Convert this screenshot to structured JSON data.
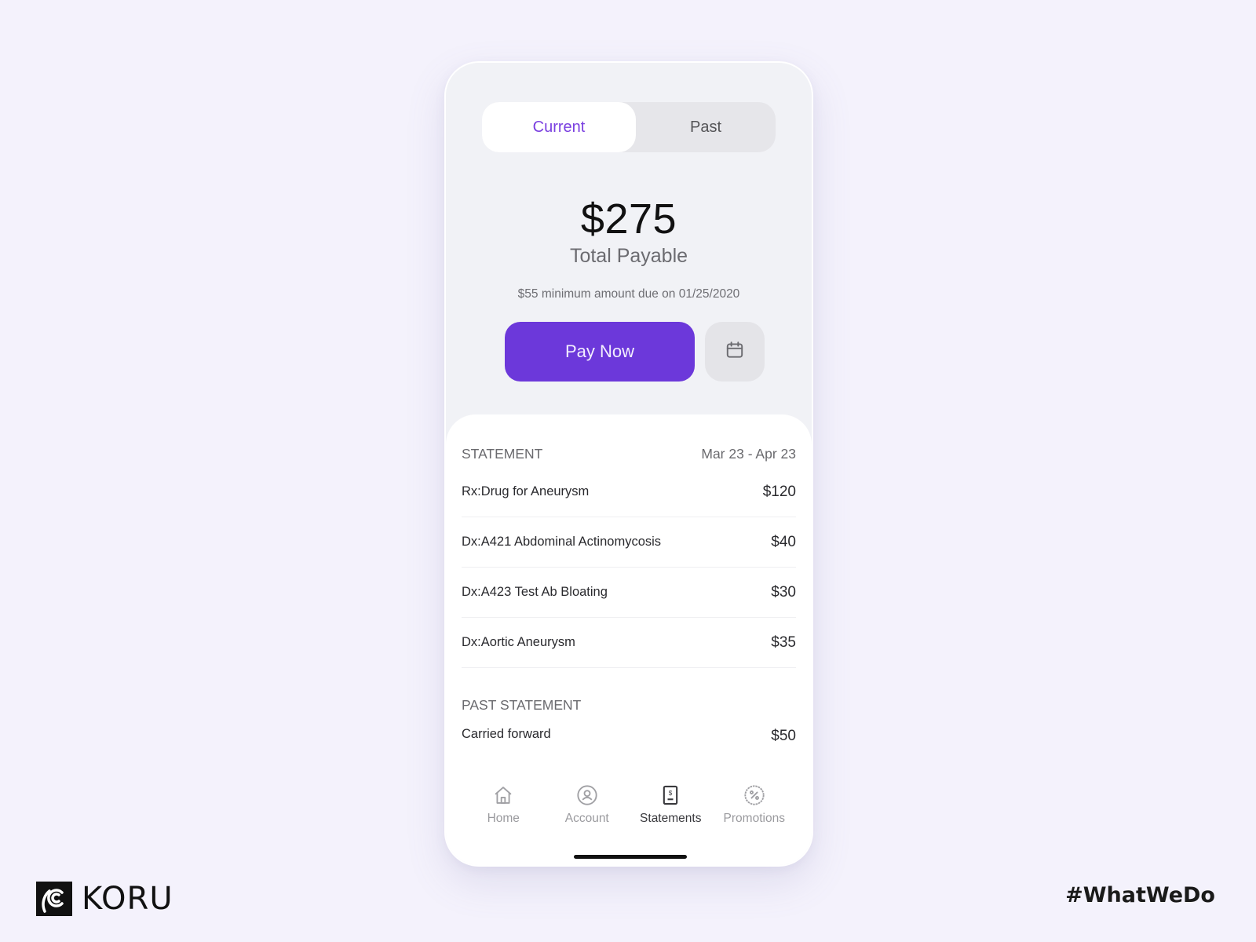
{
  "segmented_control": {
    "tabs": [
      {
        "label": "Current",
        "active": true
      },
      {
        "label": "Past",
        "active": false
      }
    ]
  },
  "summary": {
    "amount": "$275",
    "label": "Total Payable",
    "minimum_due": "$55 minimum amount due on 01/25/2020"
  },
  "actions": {
    "pay_now_label": "Pay Now",
    "schedule_icon": "calendar-icon"
  },
  "statement": {
    "title": "STATEMENT",
    "period": "Mar 23 - Apr 23",
    "items": [
      {
        "label": "Rx:Drug for Aneurysm",
        "amount": "$120"
      },
      {
        "label": "Dx:A421 Abdominal Actinomycosis",
        "amount": "$40"
      },
      {
        "label": "Dx:A423 Test Ab Bloating",
        "amount": "$30"
      },
      {
        "label": "Dx:Aortic Aneurysm",
        "amount": "$35"
      }
    ]
  },
  "past_statement": {
    "title": "PAST STATEMENT",
    "items": [
      {
        "label": "Carried forward",
        "amount": "$50"
      }
    ]
  },
  "tabbar": {
    "items": [
      {
        "label": "Home",
        "icon": "home-icon",
        "active": false
      },
      {
        "label": "Account",
        "icon": "account-icon",
        "active": false
      },
      {
        "label": "Statements",
        "icon": "statements-icon",
        "active": true
      },
      {
        "label": "Promotions",
        "icon": "promotions-icon",
        "active": false
      }
    ]
  },
  "branding": {
    "logo_text": "KORU",
    "hashtag": "#WhatWeDo"
  },
  "colors": {
    "accent": "#6c38da",
    "active_tab_text": "#7a3fe0",
    "background": "#f4f2fc"
  }
}
